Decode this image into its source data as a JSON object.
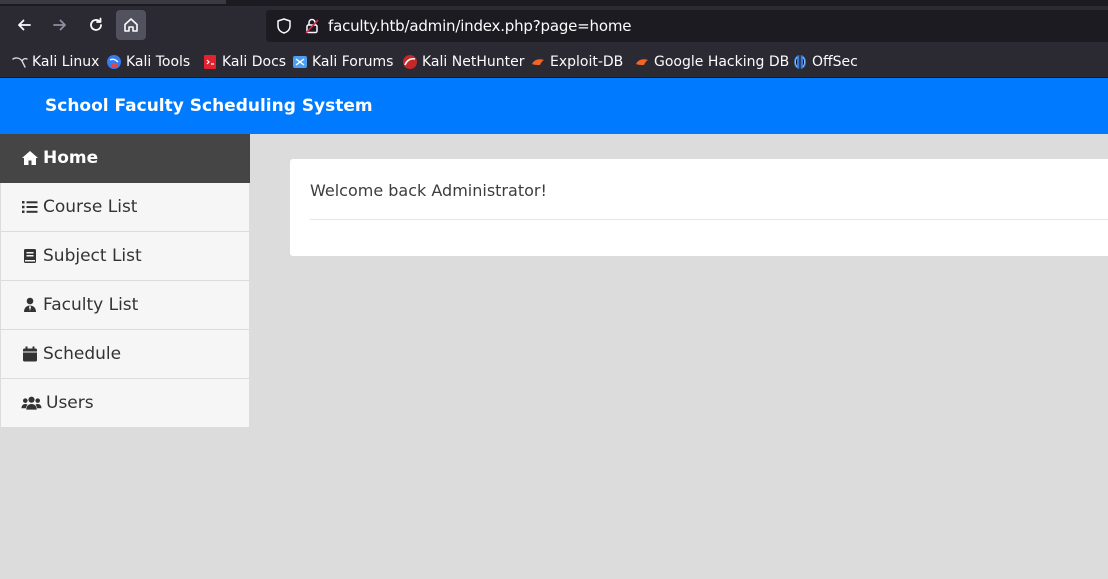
{
  "browser": {
    "url": "faculty.htb/admin/index.php?page=home",
    "bookmarks": [
      {
        "label": "Kali Linux",
        "icon": "kali-dragon-icon"
      },
      {
        "label": "Kali Tools",
        "icon": "kali-tools-icon"
      },
      {
        "label": "Kali Docs",
        "icon": "kali-docs-icon"
      },
      {
        "label": "Kali Forums",
        "icon": "kali-forums-icon"
      },
      {
        "label": "Kali NetHunter",
        "icon": "nethunter-icon"
      },
      {
        "label": "Exploit-DB",
        "icon": "exploit-db-icon"
      },
      {
        "label": "Google Hacking DB",
        "icon": "ghdb-icon"
      },
      {
        "label": "OffSec",
        "icon": "offsec-icon"
      }
    ]
  },
  "app": {
    "title": "School Faculty Scheduling System",
    "accent": "#007bff"
  },
  "sidebar": {
    "items": [
      {
        "label": "Home",
        "icon": "home-icon",
        "active": true
      },
      {
        "label": "Course List",
        "icon": "list-icon"
      },
      {
        "label": "Subject List",
        "icon": "book-icon"
      },
      {
        "label": "Faculty List",
        "icon": "user-tie-icon"
      },
      {
        "label": "Schedule",
        "icon": "calendar-icon"
      },
      {
        "label": "Users",
        "icon": "users-icon"
      }
    ]
  },
  "main": {
    "welcome": "Welcome back Administrator!"
  }
}
